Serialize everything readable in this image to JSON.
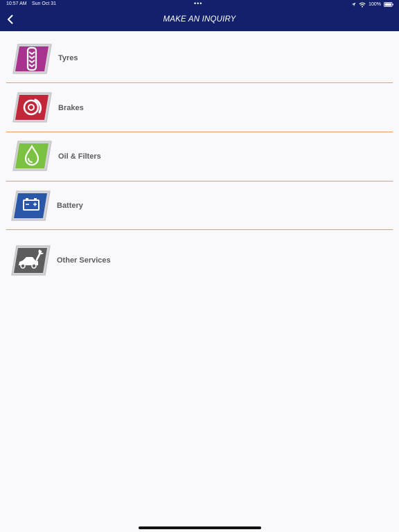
{
  "status_bar": {
    "time": "10:57 AM",
    "date": "Sun Oct 31",
    "dots": "•••",
    "battery_text": "100%"
  },
  "header": {
    "title": "MAKE AN INQUIRY",
    "back_icon": "chevron-left-icon"
  },
  "services": [
    {
      "label": "Tyres",
      "icon": "tyre-tread-icon",
      "color": "#a8338f"
    },
    {
      "label": "Brakes",
      "icon": "brake-disc-icon",
      "color": "#c0283a"
    },
    {
      "label": "Oil & Filters",
      "icon": "oil-drop-icon",
      "color": "#7cc242"
    },
    {
      "label": "Battery",
      "icon": "car-battery-icon",
      "color": "#2a57a8"
    },
    {
      "label": "Other Services",
      "icon": "car-wrench-icon",
      "color": "#5d5d5d"
    }
  ],
  "colors": {
    "header_bg": "#13206b",
    "divider": "#ef9a63",
    "background": "#f9f9fb"
  }
}
